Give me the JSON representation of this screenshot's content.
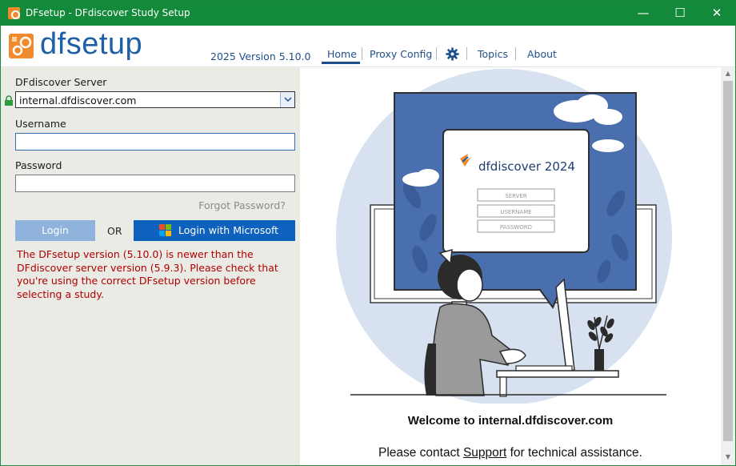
{
  "window": {
    "title": "DFsetup - DFdiscover Study Setup",
    "minimize_glyph": "—",
    "maximize_glyph": "☐",
    "close_glyph": "✕"
  },
  "header": {
    "logo_text": "dfsetup",
    "version": "2025 Version 5.10.0",
    "nav": {
      "home": "Home",
      "proxy_config": "Proxy Config",
      "settings_icon": "gear-icon",
      "topics": "Topics",
      "about": "About"
    }
  },
  "login": {
    "server_label": "DFdiscover Server",
    "server_value": "internal.dfdiscover.com",
    "username_label": "Username",
    "username_value": "",
    "password_label": "Password",
    "password_value": "",
    "forgot_password": "Forgot Password?",
    "login_button": "Login",
    "or_text": "OR",
    "microsoft_button": "Login with Microsoft",
    "error_message": "The DFsetup version (5.10.0) is newer than the DFdiscover server version (5.9.3). Please check that you're using the correct DFsetup version before selecting a study."
  },
  "illustration": {
    "brand": "dfdiscover 2024",
    "fields": [
      "SERVER",
      "USERNAME",
      "PASSWORD"
    ]
  },
  "main": {
    "welcome_prefix": "Welcome to ",
    "welcome_server": "internal.dfdiscover.com",
    "contact_prefix": "Please contact ",
    "contact_link": "Support",
    "contact_suffix": " for technical assistance."
  },
  "colors": {
    "titlebar": "#138a3a",
    "brand_blue": "#1f5fa8",
    "logo_orange": "#f08a2c",
    "ms_button": "#0e62bd",
    "error": "#b00000"
  }
}
